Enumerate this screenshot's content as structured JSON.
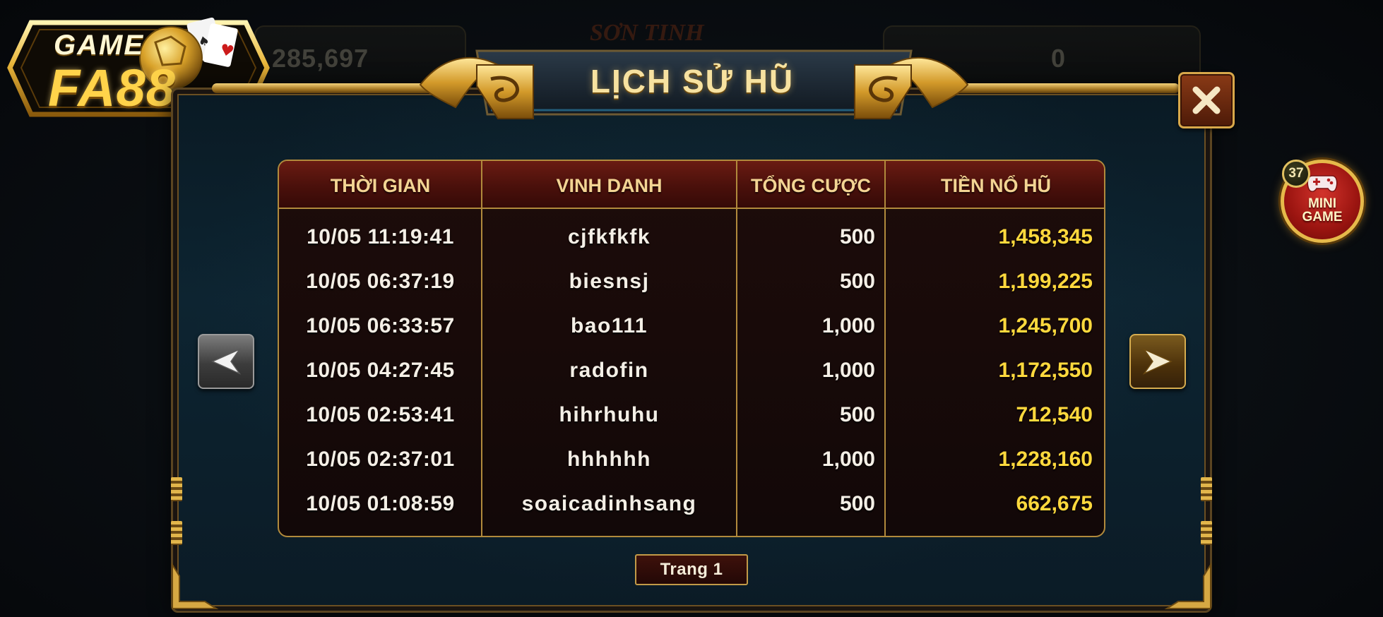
{
  "logo": {
    "line1": "GAME",
    "line2": "FA88"
  },
  "background": {
    "left_value": "285,697",
    "right_value": "0",
    "game_title": "SƠN TINH"
  },
  "dialog": {
    "title": "LỊCH SỬ HŨ",
    "close_label": "✕"
  },
  "table": {
    "headers": [
      "THỜI GIAN",
      "VINH DANH",
      "TỔNG CƯỢC",
      "TIỀN NỔ HŨ"
    ],
    "rows": [
      {
        "time": "10/05  11:19:41",
        "name": "cjfkfkfk",
        "bet": "500",
        "win": "1,458,345"
      },
      {
        "time": "10/05  06:37:19",
        "name": "biesnsj",
        "bet": "500",
        "win": "1,199,225"
      },
      {
        "time": "10/05  06:33:57",
        "name": "bao111",
        "bet": "1,000",
        "win": "1,245,700"
      },
      {
        "time": "10/05  04:27:45",
        "name": "radofin",
        "bet": "1,000",
        "win": "1,172,550"
      },
      {
        "time": "10/05  02:53:41",
        "name": "hihrhuhu",
        "bet": "500",
        "win": "712,540"
      },
      {
        "time": "10/05  02:37:01",
        "name": "hhhhhh",
        "bet": "1,000",
        "win": "1,228,160"
      },
      {
        "time": "10/05  01:08:59",
        "name": "soaicadinhsang",
        "bet": "500",
        "win": "662,675"
      }
    ]
  },
  "pagination": {
    "label": "Trang  1"
  },
  "mini_game": {
    "line1": "MINI",
    "line2": "GAME",
    "badge": "37"
  },
  "colors": {
    "win": "#ffd93d",
    "header_text": "#f3d493",
    "gold": "#b18a3c"
  }
}
